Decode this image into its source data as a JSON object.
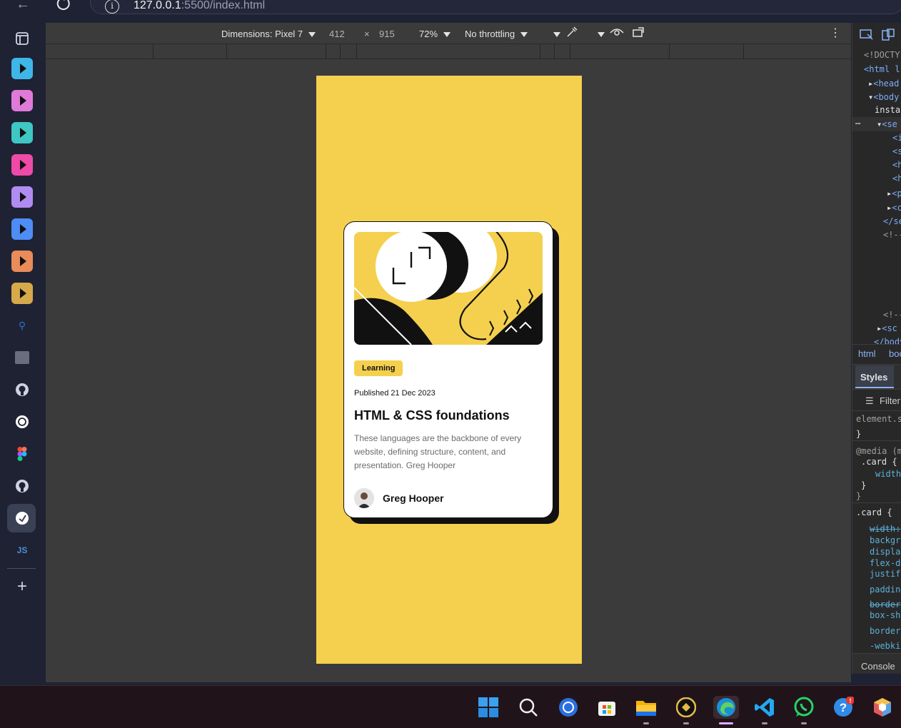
{
  "browser": {
    "url_host": "127.0.0.1",
    "url_rest": ":5500/index.html"
  },
  "devtools_toolbar": {
    "dimensions_label": "Dimensions: Pixel 7",
    "width": "412",
    "times": "×",
    "height": "915",
    "zoom": "72%",
    "throttling": "No throttling"
  },
  "card": {
    "badge": "Learning",
    "published": "Published 21 Dec 2023",
    "title": "HTML & CSS foundations",
    "description": "These languages are the backbone of every website, defining structure, content, and presentation. Greg Hooper",
    "author": "Greg Hooper"
  },
  "devtools_panel": {
    "elements_lines": [
      "<!DOCTY",
      "<html l",
      "<head",
      "<body",
      "insta",
      "<se",
      "<i",
      "<s",
      "<h",
      "<h",
      "<p",
      "<c",
      "</se",
      "<!--",
      "<!--",
      "<sc",
      "</body"
    ],
    "breadcrumb_html": "html",
    "breadcrumb_body": "boc",
    "styles_tab": "Styles",
    "filter": "Filter",
    "style_lines": [
      "element.s",
      "}",
      "@media (m",
      ".card {",
      "width",
      "}",
      "}",
      ".card {",
      "width:",
      "backgr",
      "displa",
      "flex-d",
      "justif",
      "paddin",
      "border",
      "box-sh",
      "border",
      "-webki"
    ],
    "console_tab": "Console"
  },
  "colors": {
    "card_bg": "#ffffff",
    "accent_yellow": "#f4d04e",
    "devtools_bg": "#282828"
  }
}
